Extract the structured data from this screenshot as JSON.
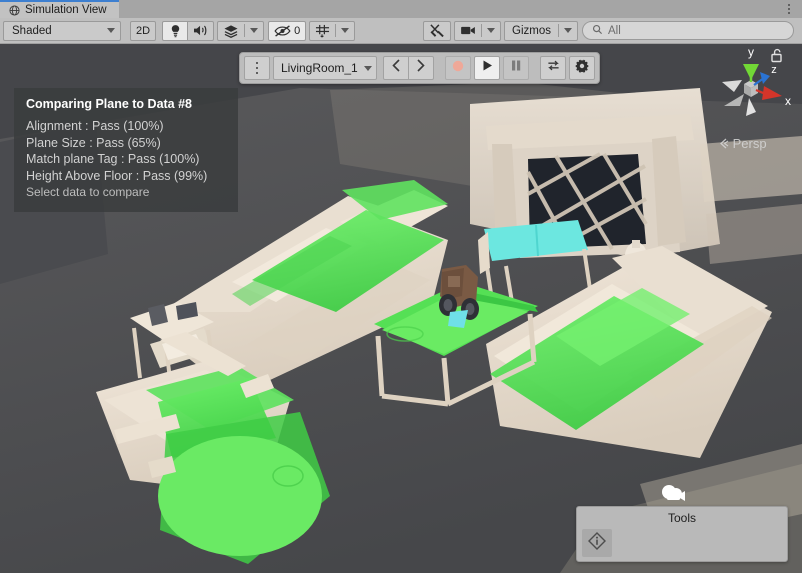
{
  "window": {
    "tab_label": "Simulation View",
    "tab_icon": "globe-icon",
    "menu_icon": "kebab-menu-icon"
  },
  "toolbar": {
    "draw_mode": {
      "value": "Shaded",
      "icon": "chevron-down-icon"
    },
    "two_d_label": "2D",
    "lighting_icon": "lightbulb-icon",
    "audio_icon": "speaker-icon",
    "effects_icon": "effects-icon",
    "effects_caret_icon": "chevron-down-icon",
    "hidden_objects_icon": "eye-off-icon",
    "hidden_objects_count": "0",
    "grid_icon": "grid-icon",
    "grid_caret_icon": "chevron-down-icon",
    "tools_icon": "tools-icon",
    "camera_icon": "camera-icon",
    "camera_caret_icon": "chevron-down-icon",
    "gizmos_label": "Gizmos",
    "gizmos_caret_icon": "chevron-down-icon",
    "search": {
      "placeholder": "All",
      "value": "",
      "icon": "search-icon"
    }
  },
  "playback": {
    "menu_icon": "kebab-menu-icon",
    "scene_name": "LivingRoom_1",
    "scene_caret_icon": "chevron-down-icon",
    "prev_icon": "chevron-left-icon",
    "next_icon": "chevron-right-icon",
    "record_icon": "record-icon",
    "play_icon": "play-icon",
    "pause_icon": "pause-icon",
    "loop_icon": "loop-icon",
    "settings_icon": "gear-icon"
  },
  "info_panel": {
    "title": "Comparing Plane to Data #8",
    "rows": [
      "Alignment : Pass (100%)",
      "Plane Size : Pass (65%)",
      "Match plane Tag : Pass (100%)",
      "Height Above Floor : Pass (99%)"
    ],
    "hint": "Select data to compare"
  },
  "tools_panel": {
    "title": "Tools",
    "button_icon": "info-diamond-icon"
  },
  "scene_gizmo": {
    "axis_x": "x",
    "axis_y": "y",
    "axis_z": "z",
    "projection": "Persp",
    "lock_icon": "lock-open-icon"
  },
  "colors": {
    "accent_tab": "#3d7fd0",
    "chrome": "#bfbfbf",
    "viewport_bg": "#4e4e50",
    "highlight_green": "#56e05a",
    "highlight_cyan": "#55e5df",
    "axis_x": "#d3352a",
    "axis_y": "#72d836",
    "axis_z": "#2a73d3",
    "record": "#efa898"
  }
}
